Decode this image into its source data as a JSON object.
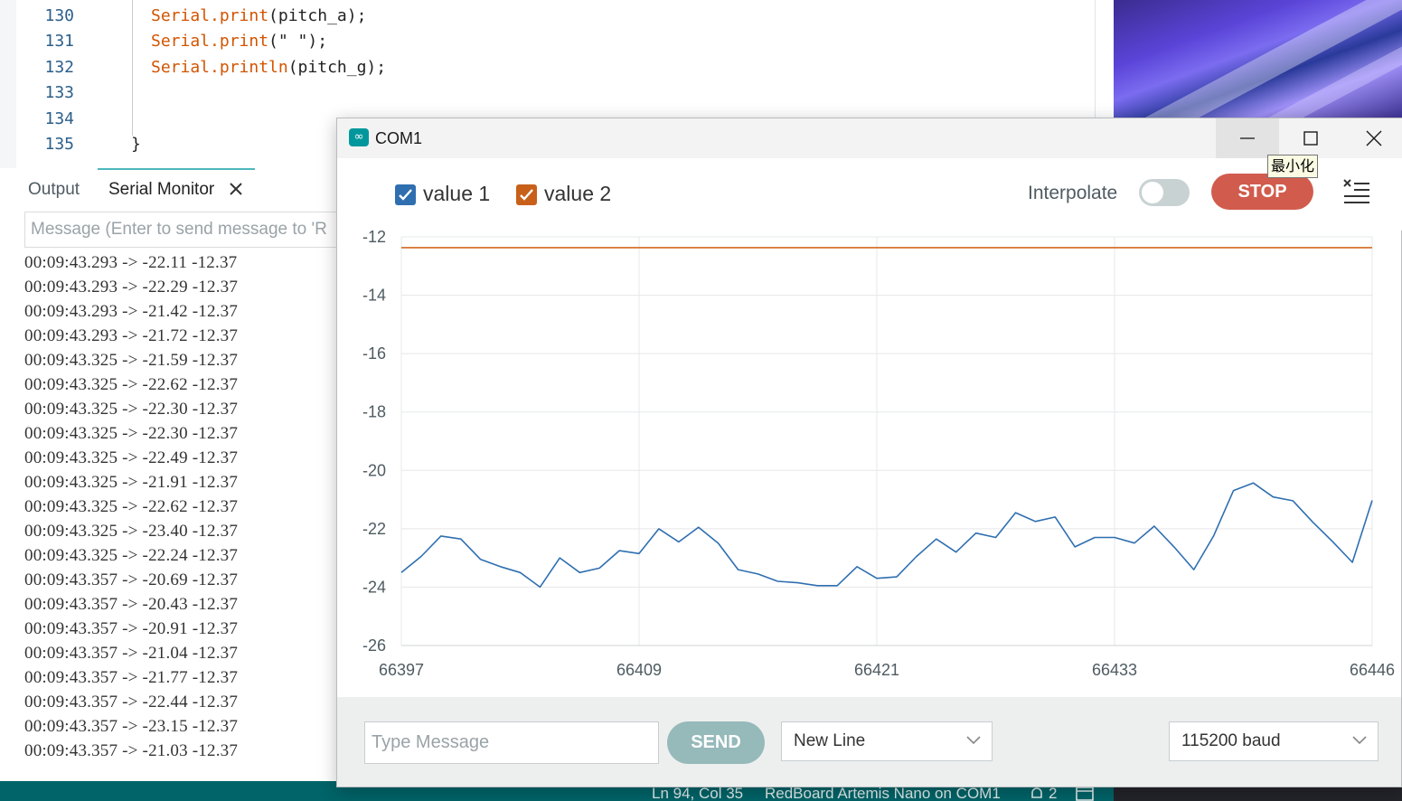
{
  "editor": {
    "lines": [
      {
        "number": "130",
        "pre": "",
        "kw": "Serial.print",
        "rest": "(pitch_a);",
        "str": ""
      },
      {
        "number": "131",
        "pre": "",
        "kw": "Serial.print",
        "rest": "(\" \");",
        "str": ""
      },
      {
        "number": "132",
        "pre": "",
        "kw": "Serial.println",
        "rest": "(pitch_g);",
        "str": ""
      },
      {
        "number": "133",
        "pre": "",
        "kw": "",
        "rest": "",
        "str": ""
      },
      {
        "number": "134",
        "pre": "",
        "kw": "",
        "rest": "",
        "str": ""
      },
      {
        "number": "135",
        "pre": "}",
        "kw": "",
        "rest": "",
        "str": ""
      }
    ]
  },
  "panel": {
    "tabs": [
      {
        "label": "Output"
      },
      {
        "label": "Serial Monitor"
      }
    ],
    "message_placeholder": "Message (Enter to send message to 'R"
  },
  "serial_output": [
    "00:09:43.293 -> -22.11 -12.37",
    "00:09:43.293 -> -22.29 -12.37",
    "00:09:43.293 -> -21.42 -12.37",
    "00:09:43.293 -> -21.72 -12.37",
    "00:09:43.325 -> -21.59 -12.37",
    "00:09:43.325 -> -22.62 -12.37",
    "00:09:43.325 -> -22.30 -12.37",
    "00:09:43.325 -> -22.30 -12.37",
    "00:09:43.325 -> -22.49 -12.37",
    "00:09:43.325 -> -21.91 -12.37",
    "00:09:43.325 -> -22.62 -12.37",
    "00:09:43.325 -> -23.40 -12.37",
    "00:09:43.325 -> -22.24 -12.37",
    "00:09:43.357 -> -20.69 -12.37",
    "00:09:43.357 -> -20.43 -12.37",
    "00:09:43.357 -> -20.91 -12.37",
    "00:09:43.357 -> -21.04 -12.37",
    "00:09:43.357 -> -21.77 -12.37",
    "00:09:43.357 -> -22.44 -12.37",
    "00:09:43.357 -> -23.15 -12.37",
    "00:09:43.357 -> -21.03 -12.37"
  ],
  "status_bar": {
    "position": "Ln 94, Col 35",
    "board": "RedBoard Artemis Nano on COM1",
    "notifications": "2"
  },
  "plotter": {
    "title": "COM1",
    "tooltip": "最小化",
    "interpolate_label": "Interpolate",
    "interpolate_on": false,
    "stop_label": "STOP",
    "send_label": "SEND",
    "message_placeholder": "Type Message",
    "line_ending": "New Line",
    "baud": "115200 baud",
    "accent_color": "#00979c",
    "stop_color": "#d15c4d"
  },
  "chart_data": {
    "type": "line",
    "x_ticks": [
      66397,
      66409,
      66421,
      66433,
      66446
    ],
    "x_range": [
      66397,
      66446
    ],
    "y_ticks": [
      -12,
      -14,
      -16,
      -18,
      -20,
      -22,
      -24,
      -26
    ],
    "ylim": [
      -26,
      -12
    ],
    "grid": true,
    "series": [
      {
        "name": "value 1",
        "color": "#2f6fb0",
        "x": [
          66397,
          66398,
          66399,
          66400,
          66401,
          66402,
          66403,
          66404,
          66405,
          66406,
          66407,
          66408,
          66409,
          66410,
          66411,
          66412,
          66413,
          66414,
          66415,
          66416,
          66417,
          66418,
          66419,
          66420,
          66421,
          66422,
          66423,
          66424,
          66425,
          66426,
          66427,
          66428,
          66429,
          66430,
          66431,
          66432,
          66433,
          66434,
          66435,
          66436,
          66437,
          66438,
          66439,
          66440,
          66441,
          66442,
          66443,
          66444,
          66445,
          66446
        ],
        "values": [
          -23.5,
          -22.95,
          -22.25,
          -22.35,
          -23.05,
          -23.3,
          -23.5,
          -24.0,
          -23.0,
          -23.5,
          -23.35,
          -22.75,
          -22.85,
          -22.0,
          -22.45,
          -21.95,
          -22.5,
          -23.4,
          -23.55,
          -23.8,
          -23.85,
          -23.95,
          -23.95,
          -23.3,
          -23.7,
          -23.65,
          -22.95,
          -22.35,
          -22.8,
          -22.15,
          -22.3,
          -21.45,
          -21.75,
          -21.6,
          -22.62,
          -22.3,
          -22.3,
          -22.49,
          -21.91,
          -22.62,
          -23.4,
          -22.24,
          -20.69,
          -20.43,
          -20.91,
          -21.04,
          -21.77,
          -22.44,
          -23.15,
          -21.03
        ]
      },
      {
        "name": "value 2",
        "color": "#d2691e",
        "x": [
          66397,
          66446
        ],
        "values": [
          -12.37,
          -12.37
        ]
      }
    ]
  }
}
